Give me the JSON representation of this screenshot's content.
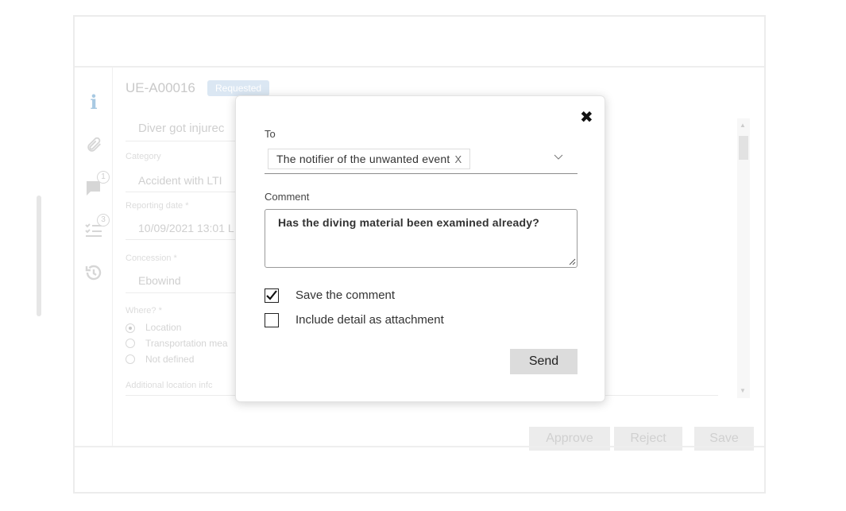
{
  "background": {
    "record_id": "UE-A00016",
    "status_badge": "Requested",
    "subject_text": "Diver got injurec",
    "category_label": "Category",
    "category_value": "Accident with LTI",
    "reporting_date_label": "Reporting date *",
    "reporting_date_value": "10/09/2021 13:01 L",
    "concession_label": "Concession *",
    "concession_value": "Ebowind",
    "where_label": "Where? *",
    "where_options": [
      "Location",
      "Transportation mea",
      "Not defined"
    ],
    "additional_label": "Additional location infc",
    "comments_badge": "1",
    "tasks_badge": "3",
    "buttons": {
      "approve": "Approve",
      "reject": "Reject",
      "save": "Save"
    }
  },
  "modal": {
    "to_label": "To",
    "to_chip": "The notifier of the unwanted event",
    "to_chip_remove": "X",
    "comment_label": "Comment",
    "comment_value": "Has the diving material been examined already?",
    "save_comment_label": "Save the comment",
    "save_comment_checked": true,
    "include_detail_label": "Include detail as attachment",
    "include_detail_checked": false,
    "send_label": "Send",
    "close_icon": "close-icon"
  }
}
